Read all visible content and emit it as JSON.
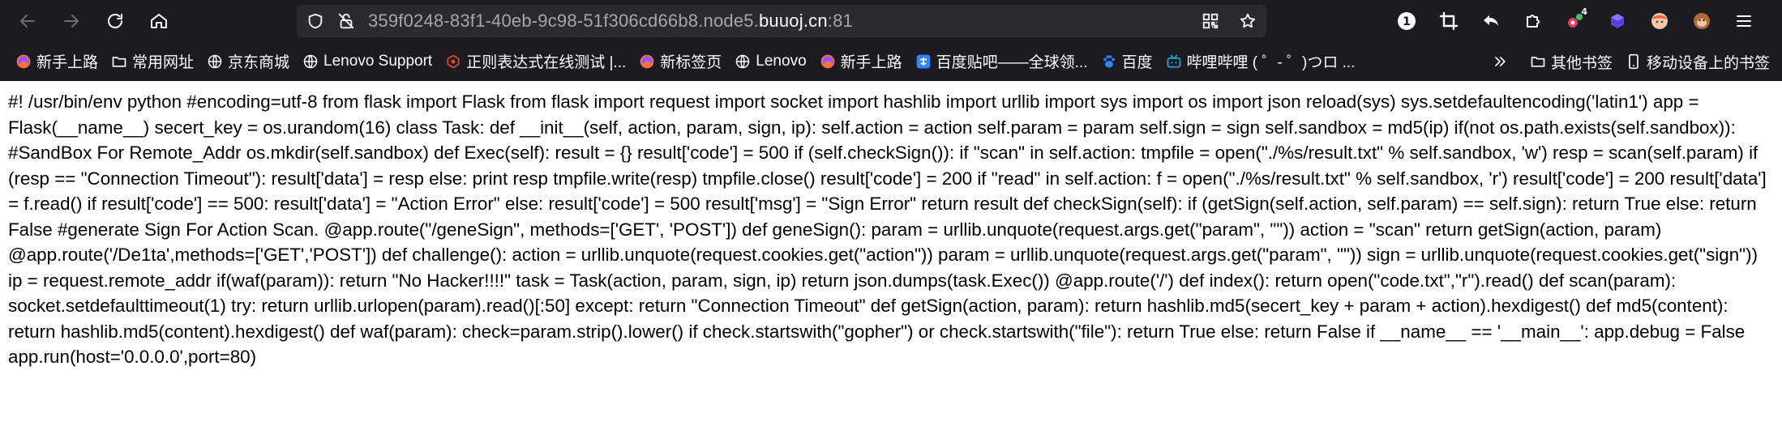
{
  "nav": {
    "back_icon": "arrow-left-icon",
    "forward_icon": "arrow-right-icon",
    "reload_icon": "reload-icon",
    "home_icon": "home-icon"
  },
  "urlbar": {
    "prefix": "359f0248-83f1-40eb-9c98-51f306cd66b8.node5.",
    "domain": "buuoj.cn",
    "suffix": ":81"
  },
  "extensions": {
    "badge_1": "1",
    "badge_4": "4"
  },
  "bookmarks": [
    {
      "label": "新手上路",
      "icon": "firefox-icon"
    },
    {
      "label": "常用网址",
      "icon": "folder-icon"
    },
    {
      "label": "京东商城",
      "icon": "globe-icon"
    },
    {
      "label": "Lenovo Support",
      "icon": "globe-icon"
    },
    {
      "label": "正则表达式在线测试 |...",
      "icon": "regex-icon"
    },
    {
      "label": "新标签页",
      "icon": "firefox-icon"
    },
    {
      "label": "Lenovo",
      "icon": "globe-icon"
    },
    {
      "label": "新手上路",
      "icon": "firefox-icon"
    },
    {
      "label": "百度贴吧——全球领...",
      "icon": "tieba-icon"
    },
    {
      "label": "百度",
      "icon": "baidu-icon"
    },
    {
      "label": "哔哩哔哩 ( ゜- ゜)つロ ...",
      "icon": "bilibili-icon"
    }
  ],
  "bookmarks_right": {
    "other": "其他书签",
    "mobile": "移动设备上的书签"
  },
  "page_text": "#! /usr/bin/env python #encoding=utf-8 from flask import Flask from flask import request import socket import hashlib import urllib import sys import os import json reload(sys) sys.setdefaultencoding('latin1') app = Flask(__name__) secert_key = os.urandom(16) class Task: def __init__(self, action, param, sign, ip): self.action = action self.param = param self.sign = sign self.sandbox = md5(ip) if(not os.path.exists(self.sandbox)): #SandBox For Remote_Addr os.mkdir(self.sandbox) def Exec(self): result = {} result['code'] = 500 if (self.checkSign()): if \"scan\" in self.action: tmpfile = open(\"./%s/result.txt\" % self.sandbox, 'w') resp = scan(self.param) if (resp == \"Connection Timeout\"): result['data'] = resp else: print resp tmpfile.write(resp) tmpfile.close() result['code'] = 200 if \"read\" in self.action: f = open(\"./%s/result.txt\" % self.sandbox, 'r') result['code'] = 200 result['data'] = f.read() if result['code'] == 500: result['data'] = \"Action Error\" else: result['code'] = 500 result['msg'] = \"Sign Error\" return result def checkSign(self): if (getSign(self.action, self.param) == self.sign): return True else: return False #generate Sign For Action Scan. @app.route(\"/geneSign\", methods=['GET', 'POST']) def geneSign(): param = urllib.unquote(request.args.get(\"param\", \"\")) action = \"scan\" return getSign(action, param) @app.route('/De1ta',methods=['GET','POST']) def challenge(): action = urllib.unquote(request.cookies.get(\"action\")) param = urllib.unquote(request.args.get(\"param\", \"\")) sign = urllib.unquote(request.cookies.get(\"sign\")) ip = request.remote_addr if(waf(param)): return \"No Hacker!!!!\" task = Task(action, param, sign, ip) return json.dumps(task.Exec()) @app.route('/') def index(): return open(\"code.txt\",\"r\").read() def scan(param): socket.setdefaulttimeout(1) try: return urllib.urlopen(param).read()[:50] except: return \"Connection Timeout\" def getSign(action, param): return hashlib.md5(secert_key + param + action).hexdigest() def md5(content): return hashlib.md5(content).hexdigest() def waf(param): check=param.strip().lower() if check.startswith(\"gopher\") or check.startswith(\"file\"): return True else: return False if __name__ == '__main__': app.debug = False app.run(host='0.0.0.0',port=80)",
  "colors": {
    "toolbar_bg": "#1c1b22",
    "urlbar_bg": "#2b2a33",
    "text_light": "#fbfbfe",
    "text_dim": "#a6a5ab"
  }
}
